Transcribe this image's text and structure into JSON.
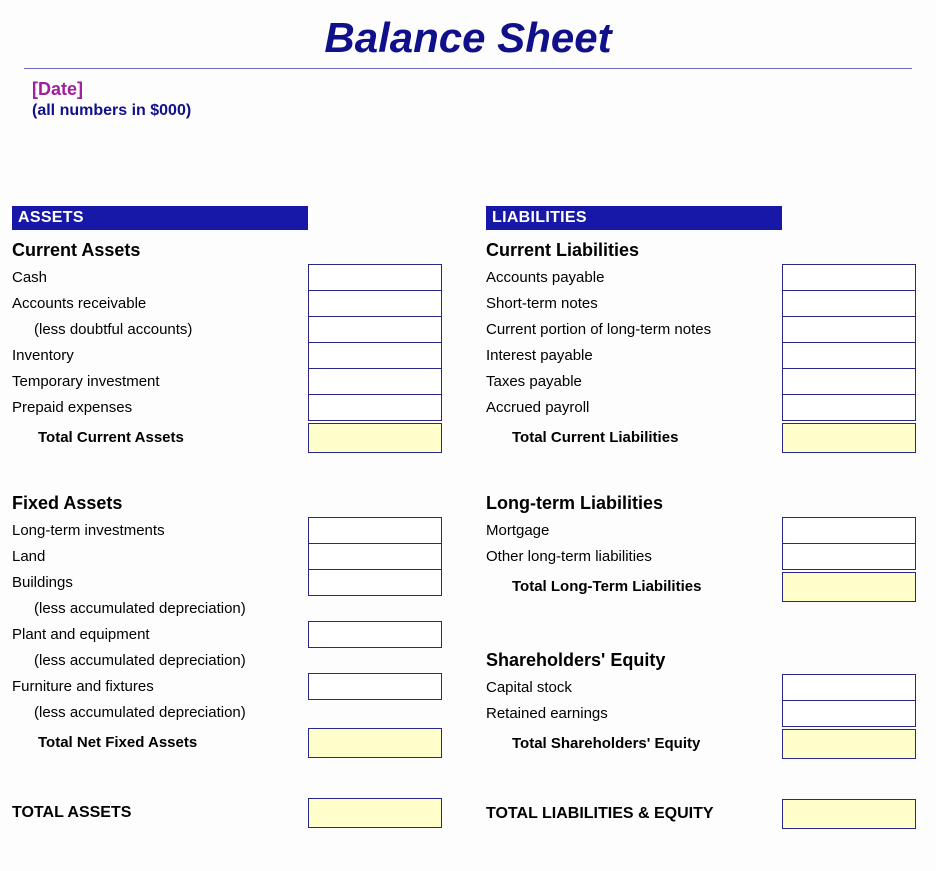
{
  "title": "Balance Sheet",
  "date_label": "[Date]",
  "units_note": "(all numbers in $000)",
  "left": {
    "bar": "ASSETS",
    "section1": {
      "heading": "Current Assets",
      "rows": [
        {
          "label": "Cash",
          "value": ""
        },
        {
          "label": "Accounts receivable",
          "value": ""
        },
        {
          "label": "(less doubtful accounts)",
          "value": "",
          "indent": true
        },
        {
          "label": "Inventory",
          "value": ""
        },
        {
          "label": "Temporary investment",
          "value": ""
        },
        {
          "label": "Prepaid expenses",
          "value": ""
        }
      ],
      "total_label": "Total Current Assets",
      "total_value": ""
    },
    "section2": {
      "heading": "Fixed Assets",
      "rows": [
        {
          "label": "Long-term investments",
          "value": ""
        },
        {
          "label": "Land",
          "value": ""
        },
        {
          "label": "Buildings",
          "value": ""
        },
        {
          "label": "(less accumulated depreciation)",
          "value": "",
          "indent": true,
          "nocell": true
        },
        {
          "label": "Plant and equipment",
          "value": ""
        },
        {
          "label": "(less accumulated depreciation)",
          "value": "",
          "indent": true,
          "nocell": true
        },
        {
          "label": "Furniture and fixtures",
          "value": ""
        },
        {
          "label": "(less accumulated depreciation)",
          "value": "",
          "indent": true,
          "nocell": true
        }
      ],
      "total_label": "Total Net Fixed Assets",
      "total_value": ""
    },
    "grand_label": "TOTAL ASSETS",
    "grand_value": ""
  },
  "right": {
    "bar": "LIABILITIES",
    "section1": {
      "heading": "Current Liabilities",
      "rows": [
        {
          "label": "Accounts payable",
          "value": ""
        },
        {
          "label": "Short-term notes",
          "value": ""
        },
        {
          "label": "Current portion of long-term notes",
          "value": ""
        },
        {
          "label": "Interest payable",
          "value": ""
        },
        {
          "label": "Taxes payable",
          "value": ""
        },
        {
          "label": "Accrued payroll",
          "value": ""
        }
      ],
      "total_label": "Total Current Liabilities",
      "total_value": ""
    },
    "section2": {
      "heading": "Long-term Liabilities",
      "rows": [
        {
          "label": "Mortgage",
          "value": ""
        },
        {
          "label": "Other long-term liabilities",
          "value": ""
        }
      ],
      "total_label": "Total Long-Term Liabilities",
      "total_value": ""
    },
    "section3": {
      "heading": "Shareholders' Equity",
      "rows": [
        {
          "label": "Capital stock",
          "value": ""
        },
        {
          "label": "Retained earnings",
          "value": ""
        }
      ],
      "total_label": "Total Shareholders' Equity",
      "total_value": ""
    },
    "grand_label": "TOTAL LIABILITIES & EQUITY",
    "grand_value": ""
  }
}
